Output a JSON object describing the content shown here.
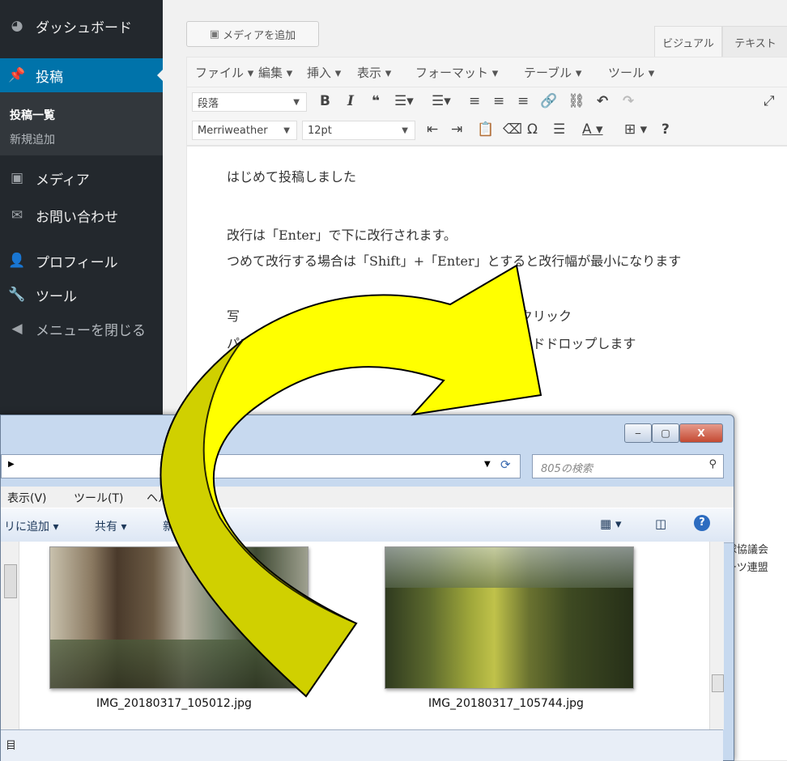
{
  "sidebar": {
    "items": [
      {
        "icon": "dashboard-icon",
        "label": "ダッシュボード"
      },
      {
        "icon": "pin-icon",
        "label": "投稿"
      },
      {
        "icon": "media-icon",
        "label": "メディア"
      },
      {
        "icon": "mail-icon",
        "label": "お問い合わせ"
      },
      {
        "icon": "user-icon",
        "label": "プロフィール"
      },
      {
        "icon": "wrench-icon",
        "label": "ツール"
      },
      {
        "icon": "collapse-icon",
        "label": "メニューを閉じる"
      }
    ],
    "submenu": [
      "投稿一覧",
      "新規追加"
    ]
  },
  "editor": {
    "add_media": "メディアを追加",
    "tabs": [
      "ビジュアル",
      "テキスト"
    ],
    "menubar": [
      "ファイル ▾",
      "編集 ▾",
      "挿入 ▾",
      "表示 ▾",
      "フォーマット ▾",
      "テーブル ▾",
      "ツール ▾"
    ],
    "format_select": "段落",
    "font_select": "Merriweather",
    "size_select": "12pt",
    "paragraphs": [
      "はじめて投稿しました",
      "改行は「Enter」で下に改行されます。",
      "つめて改行する場合は「Shift」+「Enter」とすると改行幅が最小になります",
      "写",
      "てクリック",
      "パソコン内のフォル",
      "アンドドロップします"
    ]
  },
  "explorer": {
    "search_placeholder": "805の検索",
    "menu": [
      "表示(V)",
      "ツール(T)",
      "ヘル"
    ],
    "commands": [
      "リに追加 ▾",
      "共有 ▾",
      "新"
    ],
    "files": [
      "IMG_20180317_105012.jpg",
      "IMG_20180317_105744.jpg"
    ],
    "status": "目",
    "controls": [
      "‒",
      "▢",
      "X"
    ]
  },
  "background_right": [
    "球協議会",
    "ーツ連盟"
  ]
}
